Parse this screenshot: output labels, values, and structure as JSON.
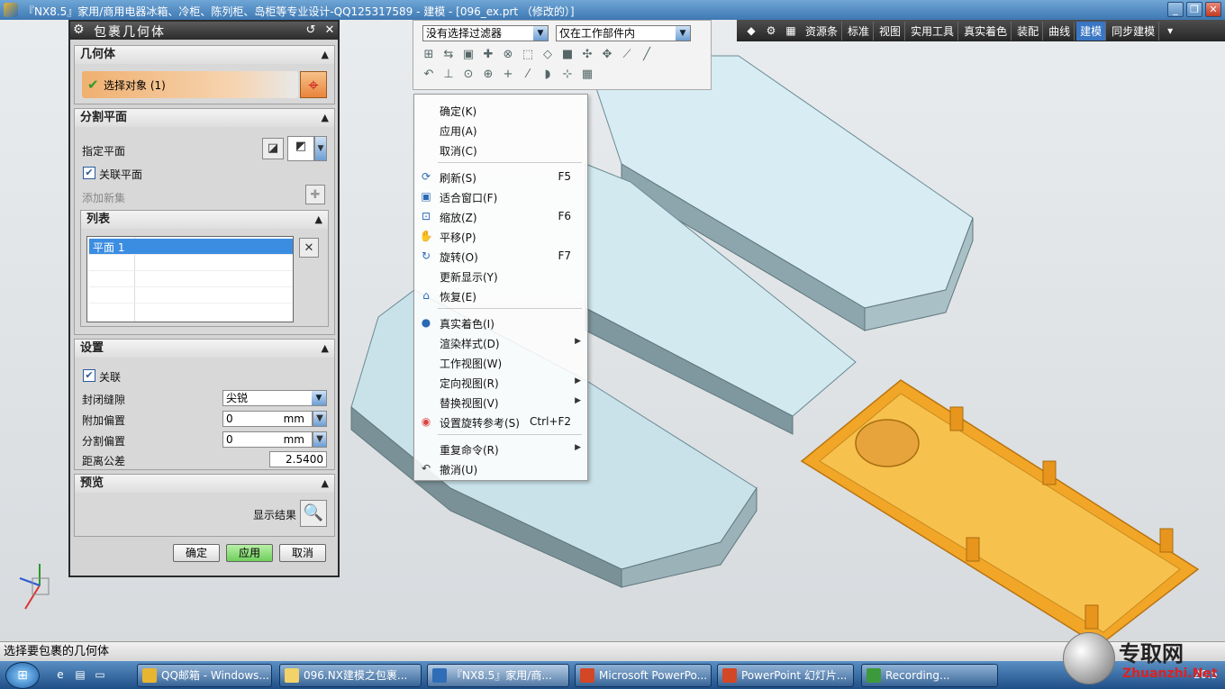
{
  "titlebar": {
    "title": "『NX8.5』家用/商用电器冰箱、冷柜、陈列柜、岛柜等专业设计-QQ125317589 - 建模 - [096_ex.prt （修改的）]",
    "minimize": "_",
    "restore": "❐",
    "close": "✕"
  },
  "toolbar": {
    "tabs": [
      "资源条",
      "标准",
      "视图",
      "实用工具",
      "真实着色",
      "装配",
      "曲线",
      "建模",
      "同步建模"
    ],
    "active_tab": "建模"
  },
  "selection_bar": {
    "filter": "没有选择过滤器",
    "scope": "仅在工作部件内"
  },
  "dialog": {
    "title": "包裹几何体",
    "sections": {
      "geometry": "几何体",
      "split_plane": "分割平面",
      "settings": "设置",
      "preview": "预览"
    },
    "select_object": "选择对象 (1)",
    "specify_plane": "指定平面",
    "associative_plane": "关联平面",
    "add_new_set": "添加新集",
    "list_label": "列表",
    "list_items": [
      {
        "name": "平面 1"
      }
    ],
    "associative": "关联",
    "close_gaps_label": "封闭缝隙",
    "close_gaps_value": "尖锐",
    "add_offset_label": "附加偏置",
    "add_offset_value": "0",
    "split_offset_label": "分割偏置",
    "split_offset_value": "0",
    "unit": "mm",
    "distance_tol_label": "距离公差",
    "distance_tol_value": "2.5400",
    "show_result": "显示结果",
    "ok": "确定",
    "apply": "应用",
    "cancel": "取消"
  },
  "context_menu": {
    "items": [
      {
        "label": "确定(K)",
        "icon": "",
        "shortcut": "",
        "submenu": false
      },
      {
        "label": "应用(A)",
        "icon": "",
        "shortcut": "",
        "submenu": false
      },
      {
        "label": "取消(C)",
        "icon": "",
        "shortcut": "",
        "submenu": false
      },
      {
        "label": "刷新(S)",
        "icon": "refresh-icon",
        "shortcut": "F5",
        "submenu": false
      },
      {
        "label": "适合窗口(F)",
        "icon": "fit-icon",
        "shortcut": "",
        "submenu": false
      },
      {
        "label": "缩放(Z)",
        "icon": "zoom-icon",
        "shortcut": "F6",
        "submenu": false
      },
      {
        "label": "平移(P)",
        "icon": "pan-icon",
        "shortcut": "",
        "submenu": false
      },
      {
        "label": "旋转(O)",
        "icon": "rotate-icon",
        "shortcut": "F7",
        "submenu": false
      },
      {
        "label": "更新显示(Y)",
        "icon": "",
        "shortcut": "",
        "submenu": false
      },
      {
        "label": "恢复(E)",
        "icon": "restore-icon",
        "shortcut": "",
        "submenu": false
      },
      {
        "label": "真实着色(I)",
        "icon": "shading-icon",
        "shortcut": "",
        "submenu": false
      },
      {
        "label": "渲染样式(D)",
        "icon": "",
        "shortcut": "",
        "submenu": true
      },
      {
        "label": "工作视图(W)",
        "icon": "",
        "shortcut": "",
        "submenu": false
      },
      {
        "label": "定向视图(R)",
        "icon": "",
        "shortcut": "",
        "submenu": true
      },
      {
        "label": "替换视图(V)",
        "icon": "",
        "shortcut": "",
        "submenu": true
      },
      {
        "label": "设置旋转参考(S)",
        "icon": "rotate-ref-icon",
        "shortcut": "Ctrl+F2",
        "submenu": false
      },
      {
        "label": "重复命令(R)",
        "icon": "",
        "shortcut": "",
        "submenu": true
      },
      {
        "label": "撤消(U)",
        "icon": "undo-icon",
        "shortcut": "",
        "submenu": false
      }
    ]
  },
  "status": {
    "prompt": "选择要包裹的几何体"
  },
  "taskbar": {
    "tasks": [
      {
        "label": "QQ邮箱 - Windows...",
        "color": "#e8b531"
      },
      {
        "label": "096.NX建模之包裹...",
        "color": "#f1d36a"
      },
      {
        "label": "『NX8.5』家用/商...",
        "color": "#2f6db6"
      },
      {
        "label": "Microsoft PowerPo...",
        "color": "#d24726"
      },
      {
        "label": "PowerPoint 幻灯片...",
        "color": "#d24726"
      },
      {
        "label": "Recording...",
        "color": "#3c9a3c"
      }
    ],
    "clock": "20:5"
  },
  "watermark": {
    "text": "专取网",
    "url": "Zhuanzhi.Net"
  },
  "colors": {
    "accent": "#3a76c4",
    "part_orange": "#f2a628",
    "part_blue": "#cfe8ef"
  }
}
